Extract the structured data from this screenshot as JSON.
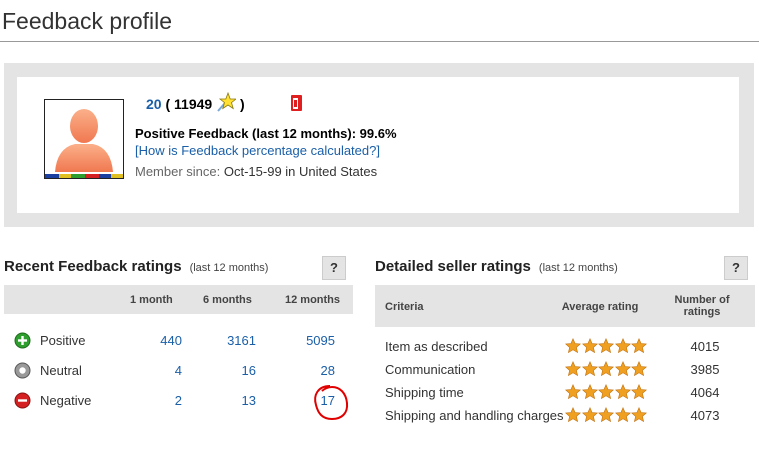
{
  "page": {
    "title": "Feedback profile"
  },
  "profile": {
    "username_fragment": "20",
    "score_open": "(",
    "score": "11949",
    "score_close": ")",
    "positive_feedback": "Positive Feedback (last 12 months): 99.6%",
    "calc_link": "[How is Feedback percentage calculated?]",
    "member_since_label": "Member since:",
    "member_since_value": "Oct-15-99 in United States",
    "icons": [
      "avatar-placeholder",
      "shooting-star-icon",
      "me-page-icon"
    ]
  },
  "recent_feedback": {
    "title": "Recent Feedback ratings",
    "subtitle": "(last 12 months)",
    "help": "?",
    "columns": [
      "1 month",
      "6 months",
      "12 months"
    ],
    "rows": [
      {
        "label": "Positive",
        "icon": "plus-circle-icon",
        "color": "#2e9e2e",
        "values": [
          "440",
          "3161",
          "5095"
        ]
      },
      {
        "label": "Neutral",
        "icon": "neutral-circle-icon",
        "color": "#888888",
        "values": [
          "4",
          "16",
          "28"
        ]
      },
      {
        "label": "Negative",
        "icon": "minus-circle-icon",
        "color": "#d42020",
        "values": [
          "2",
          "13",
          "17"
        ]
      }
    ]
  },
  "detailed_ratings": {
    "title": "Detailed seller ratings",
    "subtitle": "(last 12 months)",
    "help": "?",
    "columns": {
      "criteria": "Criteria",
      "average": "Average rating",
      "count_line1": "Number of",
      "count_line2": "ratings"
    },
    "rows": [
      {
        "label": "Item as described",
        "stars": 5,
        "count": "4015"
      },
      {
        "label": "Communication",
        "stars": 5,
        "count": "3985"
      },
      {
        "label": "Shipping time",
        "stars": 5,
        "count": "4064"
      },
      {
        "label": "Shipping and handling charges",
        "stars": 5,
        "count": "4073"
      }
    ]
  },
  "colors": {
    "link": "#1a5fa8",
    "star": "#f0a020",
    "annotation": "#e00000"
  }
}
